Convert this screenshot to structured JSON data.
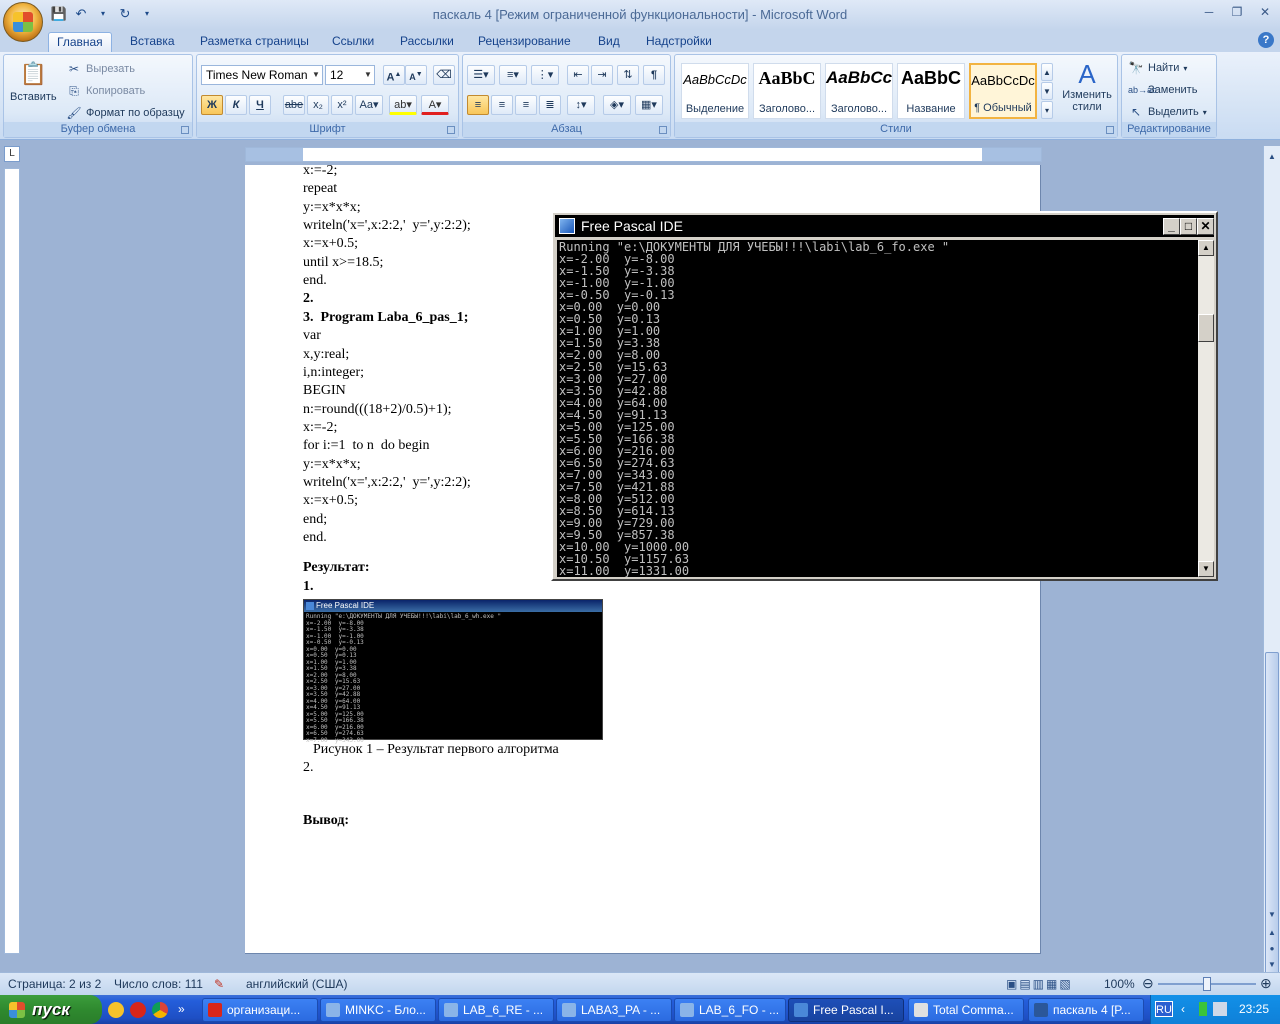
{
  "window": {
    "title": "паскаль 4 [Режим ограниченной функциональности] - Microsoft Word"
  },
  "tabs": [
    "Главная",
    "Вставка",
    "Разметка страницы",
    "Ссылки",
    "Рассылки",
    "Рецензирование",
    "Вид",
    "Надстройки"
  ],
  "ribbon": {
    "clipboard": {
      "label": "Буфер обмена",
      "paste": "Вставить",
      "cut": "Вырезать",
      "copy": "Копировать",
      "format_painter": "Формат по образцу"
    },
    "font": {
      "label": "Шрифт",
      "family": "Times New Roman",
      "size": "12"
    },
    "paragraph": {
      "label": "Абзац"
    },
    "styles": {
      "label": "Стили",
      "items": [
        {
          "sample": "AaBbCcDc",
          "name": "Выделение"
        },
        {
          "sample": "AaBbC",
          "name": "Заголово..."
        },
        {
          "sample": "AaBbCc",
          "name": "Заголово..."
        },
        {
          "sample": "AaBbC",
          "name": "Название"
        },
        {
          "sample": "AaBbCcDc",
          "name": "¶ Обычный"
        }
      ],
      "change": "Изменить стили"
    },
    "editing": {
      "label": "Редактирование",
      "find": "Найти",
      "replace": "Заменить",
      "select": "Выделить"
    }
  },
  "document": {
    "lines": [
      "x:=-2;",
      "repeat",
      "y:=x*x*x;",
      "writeln('x=',x:2:2,'  y=',y:2:2);",
      "x:=x+0.5;",
      "until x>=18.5;",
      "end.",
      "2.",
      "3.  Program Laba_6_pas_1;",
      "var",
      "x,y:real;",
      "i,n:integer;",
      "BEGIN",
      "n:=round(((18+2)/0.5)+1);",
      "x:=-2;",
      "for i:=1  to n  do begin",
      "y:=x*x*x;",
      "writeln('x=',x:2:2,'  y=',y:2:2);",
      "x:=x+0.5;",
      "end;",
      "end."
    ],
    "result_label": "Результат:",
    "result_num": "1.",
    "figure_caption": "Рисунок 1 – Результат первого алгоритма",
    "item2": "2.",
    "conclusion": "Вывод:",
    "thumb_title": "Free Pascal IDE",
    "thumb_lines": "Running \"e:\\ДОКУМЕНТЫ ДЛЯ УЧЕБЫ!!!\\labi\\lab_6_wh.exe \"\nx=-2.00  y=-8.00\nx=-1.50  y=-3.38\nx=-1.00  y=-1.00\nx=-0.50  y=-0.13\nx=0.00  y=0.00\nx=0.50  y=0.13\nx=1.00  y=1.00\nx=1.50  y=3.38\nx=2.00  y=8.00\nx=2.50  y=15.63\nx=3.00  y=27.00\nx=3.50  y=42.88\nx=4.00  y=64.00\nx=4.50  y=91.13\nx=5.00  y=125.00\nx=5.50  y=166.38\nx=6.00  y=216.00\nx=6.50  y=274.63\nx=7.00  y=343.00"
  },
  "pascal": {
    "title": "Free Pascal IDE",
    "output": "Running \"e:\\ДОКУМЕНТЫ ДЛЯ УЧЕБЫ!!!\\labi\\lab_6_fo.exe \"\nx=-2.00  y=-8.00\nx=-1.50  y=-3.38\nx=-1.00  y=-1.00\nx=-0.50  y=-0.13\nx=0.00  y=0.00\nx=0.50  y=0.13\nx=1.00  y=1.00\nx=1.50  y=3.38\nx=2.00  y=8.00\nx=2.50  y=15.63\nx=3.00  y=27.00\nx=3.50  y=42.88\nx=4.00  y=64.00\nx=4.50  y=91.13\nx=5.00  y=125.00\nx=5.50  y=166.38\nx=6.00  y=216.00\nx=6.50  y=274.63\nx=7.00  y=343.00\nx=7.50  y=421.88\nx=8.00  y=512.00\nx=8.50  y=614.13\nx=9.00  y=729.00\nx=9.50  y=857.38\nx=10.00  y=1000.00\nx=10.50  y=1157.63\nx=11.00  y=1331.00"
  },
  "status": {
    "page": "Страница: 2 из 2",
    "words": "Число слов: 111",
    "lang": "английский (США)",
    "zoom": "100%"
  },
  "taskbar": {
    "start": "пуск",
    "tasks": [
      "организаци...",
      "MINKC - Бло...",
      "LAB_6_RE - ...",
      "LABA3_PA - ...",
      "LAB_6_FO - ...",
      "Free Pascal I...",
      "Total Comma...",
      "паскаль 4 [P..."
    ],
    "lang": "RU",
    "clock": "23:25"
  }
}
